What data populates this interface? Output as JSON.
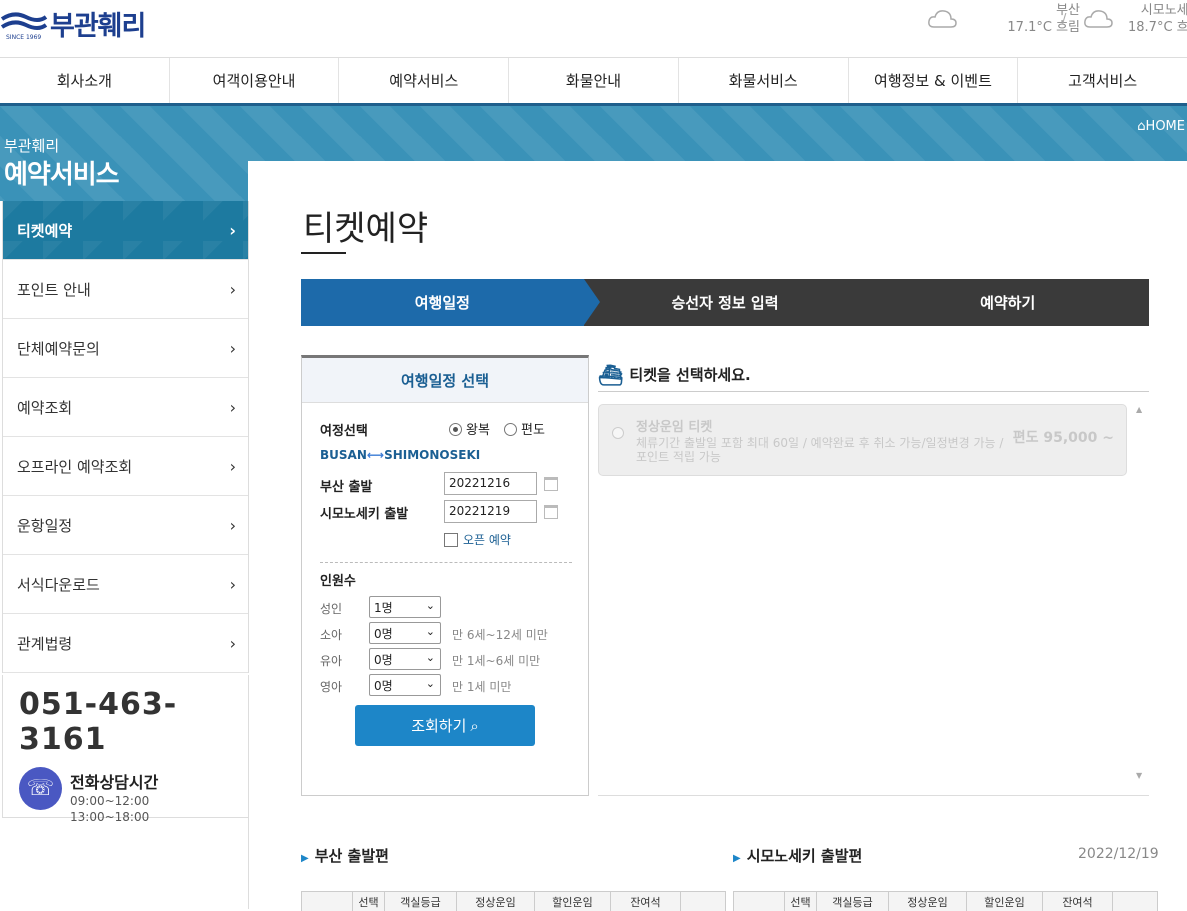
{
  "brand": {
    "logo_text": "부관훼리",
    "logo_sub": "SINCE 1969"
  },
  "weather": [
    {
      "city": "부산",
      "temp": "17.1°C",
      "cond": "흐림"
    },
    {
      "city": "시모노세",
      "temp": "18.7°C",
      "cond": "흐"
    }
  ],
  "weather_sep": "/",
  "nav": [
    "회사소개",
    "여객이용안내",
    "예약서비스",
    "화물안내",
    "화물서비스",
    "여행정보 & 이벤트",
    "고객서비스"
  ],
  "breadcrumb": "HOME",
  "sidebar": {
    "sub": "부관훼리",
    "title": "예약서비스",
    "items": [
      "티켓예약",
      "포인트 안내",
      "단체예약문의",
      "예약조회",
      "오프라인 예약조회",
      "운항일정",
      "서식다운로드",
      "관계법령"
    ],
    "chevron": "›",
    "phone": "051-463-3161",
    "hours_title": "전화상담시간",
    "hours": [
      "09:00~12:00",
      "13:00~18:00"
    ]
  },
  "page_title": "티켓예약",
  "steps": [
    "여행일정",
    "승선자 정보 입력",
    "예약하기"
  ],
  "schedule": {
    "head": "여행일정 선택",
    "trip_label": "여정선택",
    "round": "왕복",
    "oneway": "편도",
    "route_from": "BUSAN",
    "route_to": "SHIMONOSEKI",
    "dep1_label": "부산 출발",
    "dep1_value": "20221216",
    "dep2_label": "시모노세키 출발",
    "dep2_value": "20221219",
    "open_label": "오픈 예약",
    "people_label": "인원수",
    "rows": [
      {
        "label": "성인",
        "value": "1명",
        "hint": ""
      },
      {
        "label": "소아",
        "value": "0명",
        "hint": "만 6세~12세 미만"
      },
      {
        "label": "유아",
        "value": "0명",
        "hint": "만 1세~6세 미만"
      },
      {
        "label": "영아",
        "value": "0명",
        "hint": "만 1세 미만"
      }
    ],
    "search": "조회하기"
  },
  "ticket": {
    "head": "티켓을 선택하세요.",
    "name": "정상운임 티켓",
    "desc": "체류기간 출발일 포함 최대 60일 / 예약완료 후 취소 가능/일정변경 가능 / 포인트 적립 가능",
    "price": "편도 95,000 ~"
  },
  "bottom": {
    "busan": "부산 출발편",
    "shimo": "시모노세키 출발편",
    "date": "2022/12/19",
    "cols": [
      "선택",
      "객실등급",
      "정상운임",
      "할인운임",
      "잔여석"
    ]
  }
}
